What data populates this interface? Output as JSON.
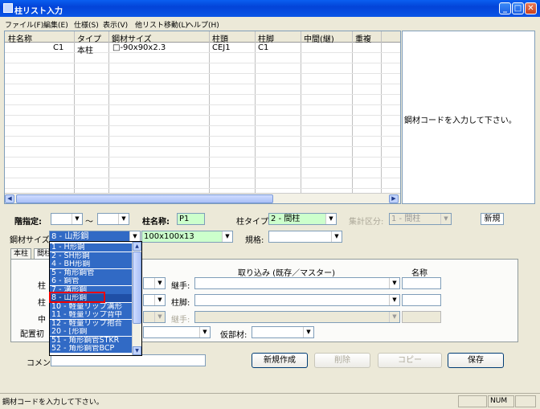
{
  "window": {
    "title": "柱リスト入力",
    "min": "_",
    "max": "□",
    "close": "✕"
  },
  "menu": [
    "ファイル(F)",
    "編集(E)",
    "仕様(S)",
    "表示(V)",
    "他リスト移動(L)",
    "ヘルプ(H)"
  ],
  "grid": {
    "headers": [
      "柱名称",
      "タイプ",
      "鋼材サイズ",
      "柱頭",
      "柱脚",
      "中間(継)",
      "重複"
    ],
    "rows": [
      [
        "C1",
        "本柱",
        "□-90x90x2.3",
        "CEJ1",
        "C1",
        "",
        ""
      ]
    ]
  },
  "right_panel": {
    "message": "鋼材コードを入力して下さい。"
  },
  "form": {
    "floor_label": "階指定:",
    "tilde": "〜",
    "col_name_label": "柱名称:",
    "col_name_value": "P1",
    "col_type_label": "柱タイプ:",
    "col_type_value": "2 - 間柱",
    "agg_label": "集計区分:",
    "agg_value": "1 - 間柱",
    "new_badge": "新規",
    "steel_label": "鋼材サイズ:",
    "steel_value": "8 - 山形鋼",
    "size_value": "100x100x13",
    "spec_label": "規格:",
    "tab_main": "本柱",
    "tab_mid": "間柱",
    "import_label": "取り込み (既存／マスター)",
    "name_label": "名称",
    "joint_label": "継手:",
    "base_label": "柱脚:",
    "joint2_label": "継手:",
    "row_label_1": "柱",
    "row_label_2": "柱",
    "row_label_3": "中",
    "layout_label": "配置初",
    "temp_label": "仮部材:",
    "comment_label": "コメント:",
    "btn_new": "新規作成",
    "btn_delete": "削除",
    "btn_copy": "コピー",
    "btn_save": "保存"
  },
  "dropdown": {
    "items": [
      "1 - H形鋼",
      "2 - SH形鋼",
      "4 - BH形鋼",
      "5 - 角形鋼管",
      "6 - 鋼管",
      "7 - 溝形鋼",
      "8 - 山形鋼",
      "10 - 軽量リップ溝形",
      "11 - 軽量リップ背中",
      "12 - 軽量リップ抱合",
      "20 - [形鋼",
      "51 - 角形鋼管STKR",
      "52 - 角形鋼管BCP"
    ],
    "selected": "8 - 山形鋼"
  },
  "status": {
    "text": "鋼材コードを入力して下さい。",
    "num": "NUM"
  }
}
